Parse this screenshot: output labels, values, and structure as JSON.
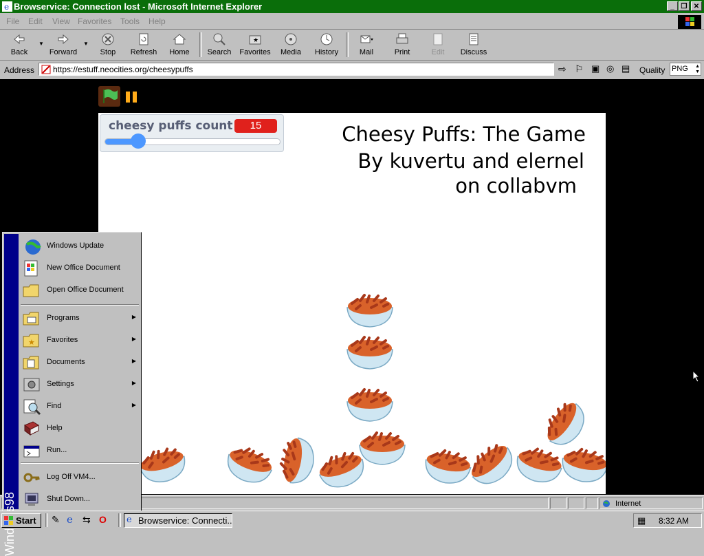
{
  "window": {
    "title": "Browservice: Connection lost - Microsoft Internet Explorer"
  },
  "menubar": [
    "File",
    "Edit",
    "View",
    "Favorites",
    "Tools",
    "Help"
  ],
  "toolbar": {
    "back": "Back",
    "forward": "Forward",
    "stop": "Stop",
    "refresh": "Refresh",
    "home": "Home",
    "search": "Search",
    "favorites": "Favorites",
    "media": "Media",
    "history": "History",
    "mail": "Mail",
    "print": "Print",
    "edit": "Edit",
    "discuss": "Discuss"
  },
  "address": {
    "label": "Address",
    "url": "https://estuff.neocities.org/cheesypuffs",
    "quality_label": "Quality",
    "quality_value": "PNG"
  },
  "game": {
    "monitor_label": "cheesy puffs count",
    "monitor_value": "15",
    "slider_fraction": 0.15,
    "title_line1": "Cheesy Puffs: The Game",
    "title_line2": "By kuvertu and elernel",
    "title_line3": "on collabvm"
  },
  "statusbar": {
    "zone": "Internet"
  },
  "taskbar": {
    "start": "Start",
    "task": "Browservice: Connecti...",
    "clock": "8:32 AM"
  },
  "startmenu": {
    "sidebar": "Windows98",
    "top_items": [
      "Windows Update",
      "New Office Document",
      "Open Office Document"
    ],
    "main_items": [
      "Programs",
      "Favorites",
      "Documents",
      "Settings",
      "Find",
      "Help",
      "Run..."
    ],
    "bottom_items": [
      "Log Off VM4...",
      "Shut Down..."
    ]
  },
  "colors": {
    "titlebar": "#0a6e0a",
    "monitor_value_bg": "#e0211c",
    "slider": "#4c97ff",
    "startmenu_sidebar": "#00008a"
  }
}
